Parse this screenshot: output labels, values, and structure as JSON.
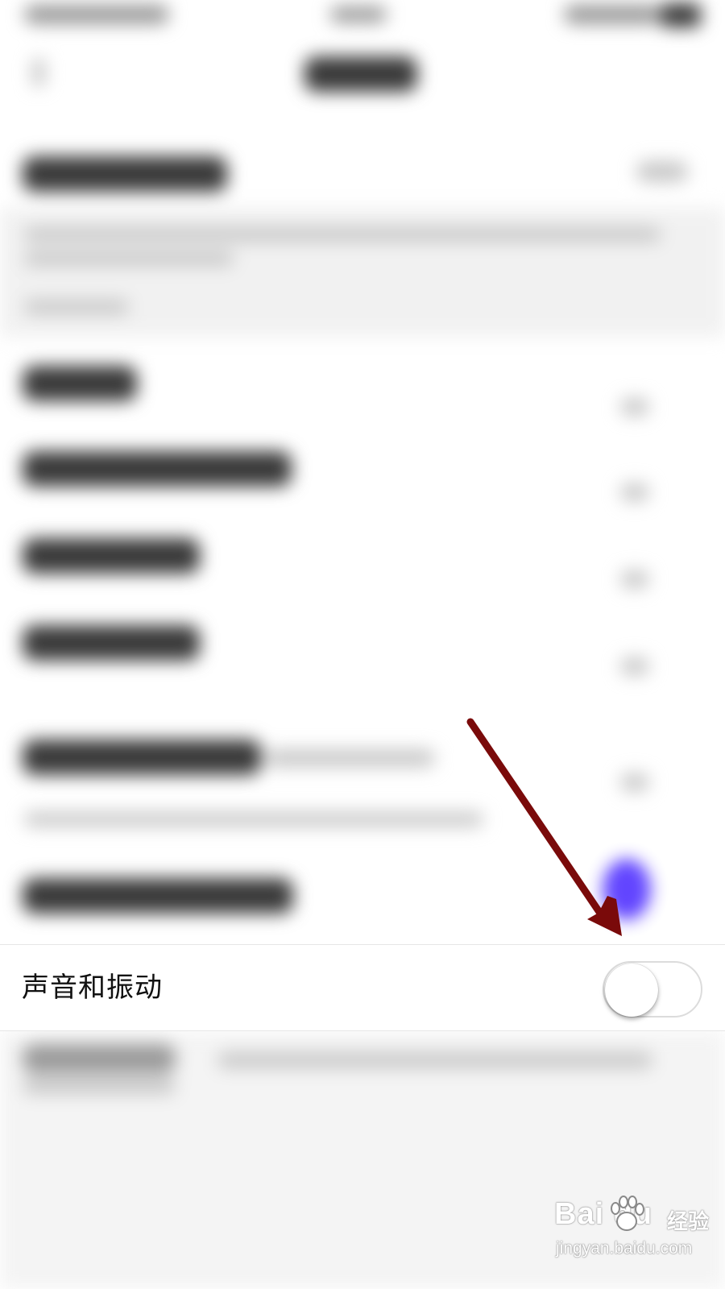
{
  "settings": {
    "highlighted_item": {
      "label": "声音和振动",
      "toggle_on": false
    }
  },
  "annotation": {
    "arrow_color": "#7a0a0a",
    "tap_color": "#5a3cff"
  },
  "watermark": {
    "logo": "Bai du",
    "brand": "经验",
    "url": "jingyan.baidu.com"
  }
}
